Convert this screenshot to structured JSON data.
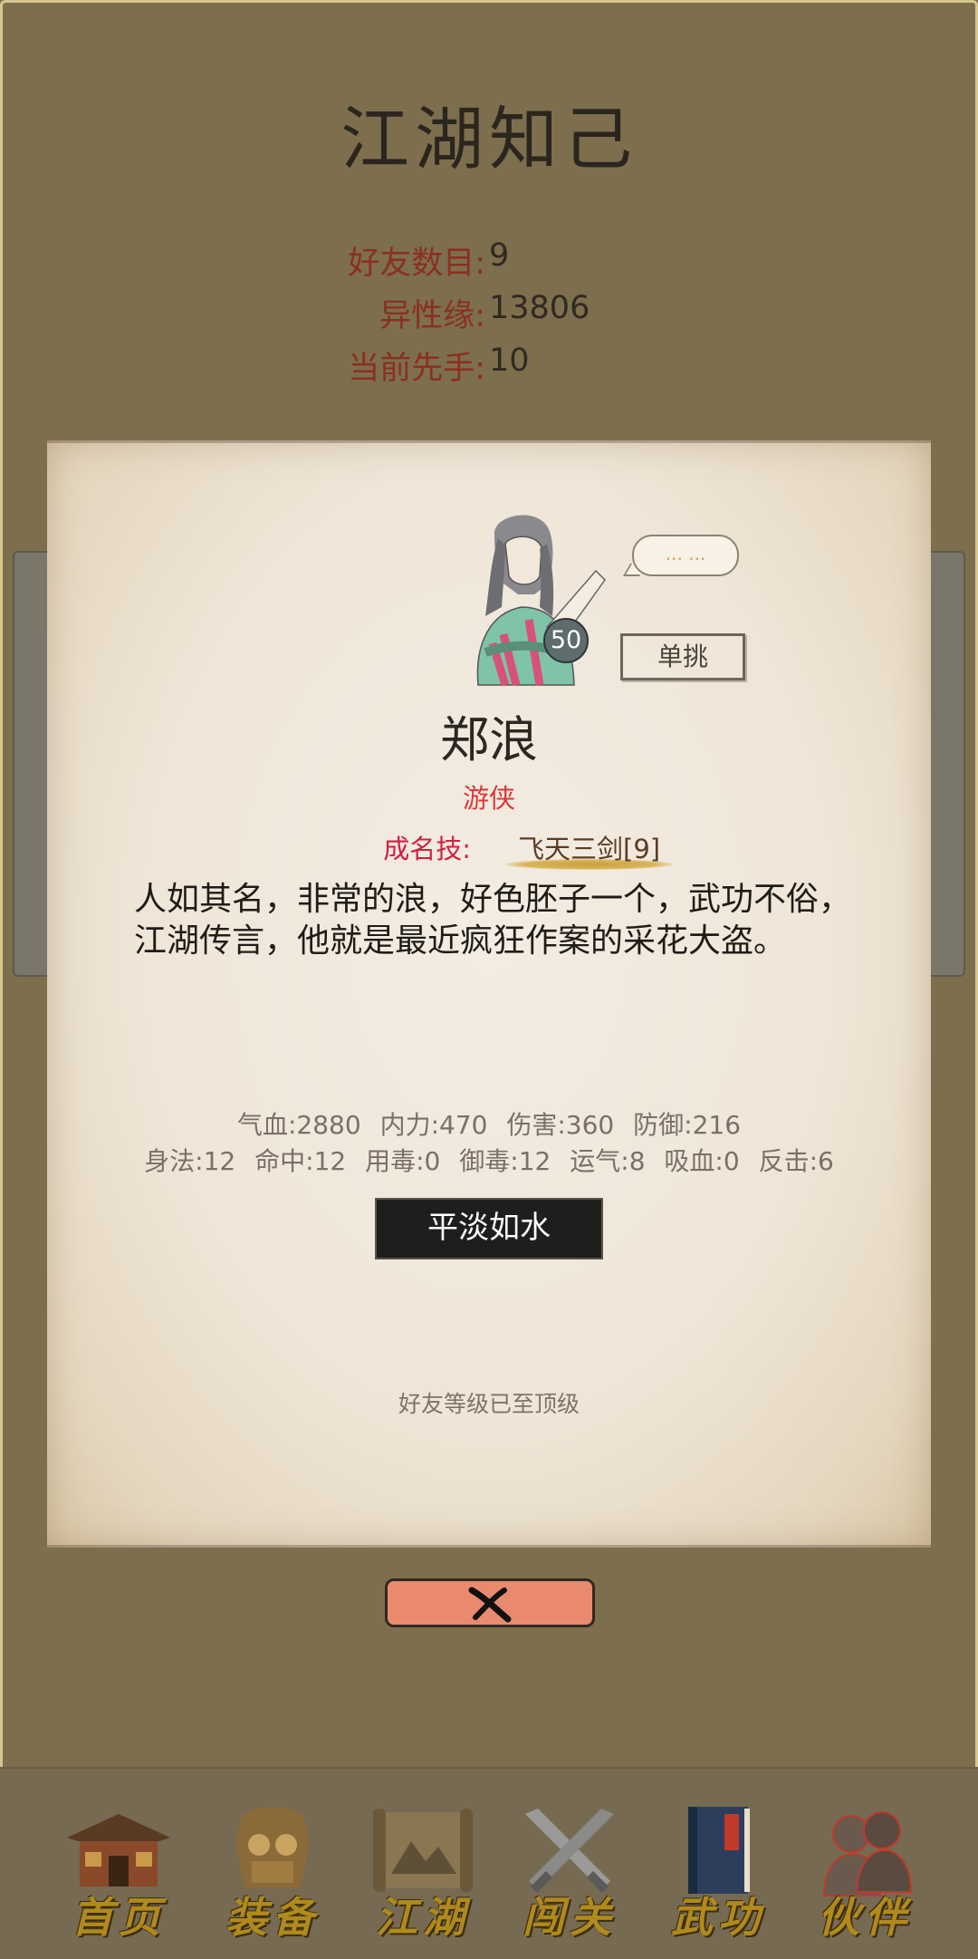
{
  "header": {
    "title": "江湖知己",
    "stats": [
      {
        "label": "好友数目:",
        "value": "9"
      },
      {
        "label": "异性缘:",
        "value": "13806"
      },
      {
        "label": "当前先手:",
        "value": "10"
      }
    ]
  },
  "card": {
    "level": "50",
    "speech": "... ...",
    "duel_label": "单挑",
    "name": "郑浪",
    "class": "游侠",
    "skill_label": "成名技:",
    "skill_value": "飞天三剑[9]",
    "description": "人如其名，非常的浪，好色胚子一个，武功不俗，江湖传言，他就是最近疯狂作案的采花大盗。",
    "attrs_row1": [
      "气血:2880",
      "内力:470",
      "伤害:360",
      "防御:216"
    ],
    "attrs_row2": [
      "身法:12",
      "命中:12",
      "用毒:0",
      "御毒:12",
      "运气:8",
      "吸血:0",
      "反击:6"
    ],
    "mood": "平淡如水",
    "friend_status": "好友等级已至顶级"
  },
  "close_icon": "close-x-icon",
  "nav": {
    "items": [
      {
        "label": "首页",
        "icon": "home-pavilion-icon"
      },
      {
        "label": "装备",
        "icon": "armor-icon"
      },
      {
        "label": "江湖",
        "icon": "scroll-map-icon"
      },
      {
        "label": "闯关",
        "icon": "crossed-swords-icon"
      },
      {
        "label": "武功",
        "icon": "martial-book-icon"
      },
      {
        "label": "伙伴",
        "icon": "partners-icon"
      }
    ],
    "active_index": 5
  },
  "colors": {
    "background": "#7d6e4d",
    "card": "#f0e8dc",
    "stat_label": "#8a3020",
    "class_red": "#d93a3a",
    "close_button": "#e98a6f",
    "nav_label_gold": "#b08a1c"
  }
}
